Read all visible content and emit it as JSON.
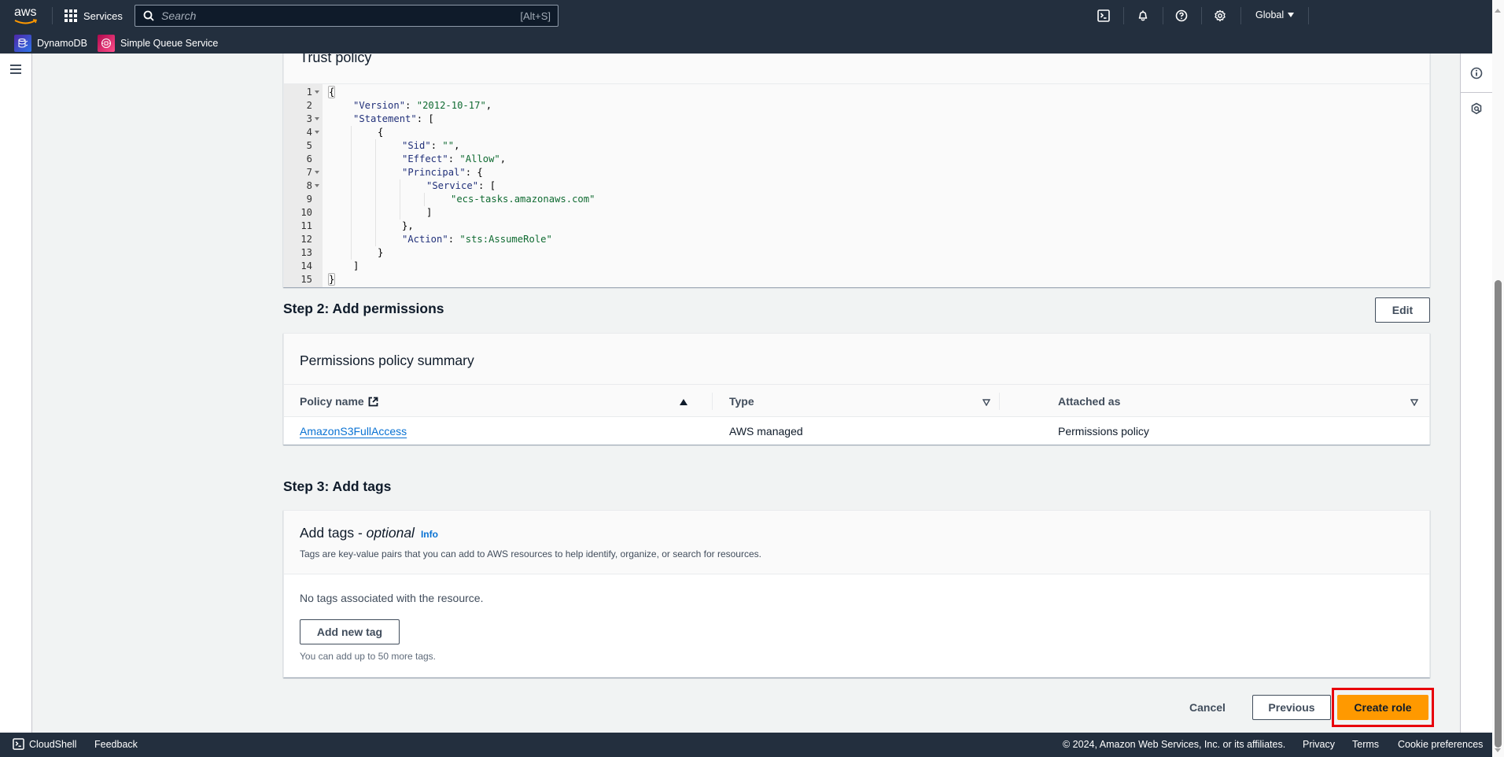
{
  "topnav": {
    "logo_text": "aws",
    "services_label": "Services",
    "search_placeholder": "Search",
    "search_shortcut": "[Alt+S]",
    "icons": [
      "cloudshell-icon",
      "bell-icon",
      "help-icon",
      "settings-icon"
    ],
    "region_label": "Global",
    "favorites": [
      {
        "label": "DynamoDB",
        "icon": "dynamodb-icon",
        "color": "#3f48cc"
      },
      {
        "label": "Simple Queue Service",
        "icon": "sqs-icon",
        "color": "#e7157b"
      }
    ]
  },
  "trust_policy": {
    "title": "Trust policy",
    "lines": [
      {
        "n": "1",
        "fold": true,
        "indent": 0,
        "html": "{"
      },
      {
        "n": "2",
        "fold": false,
        "indent": 1,
        "key": "\"Version\"",
        "sep": ": ",
        "str": "\"2012-10-17\"",
        "tail": ","
      },
      {
        "n": "3",
        "fold": true,
        "indent": 1,
        "key": "\"Statement\"",
        "sep": ": [",
        "str": "",
        "tail": ""
      },
      {
        "n": "4",
        "fold": true,
        "indent": 2,
        "plain": "{"
      },
      {
        "n": "5",
        "fold": false,
        "indent": 3,
        "key": "\"Sid\"",
        "sep": ": ",
        "str": "\"\"",
        "tail": ","
      },
      {
        "n": "6",
        "fold": false,
        "indent": 3,
        "key": "\"Effect\"",
        "sep": ": ",
        "str": "\"Allow\"",
        "tail": ","
      },
      {
        "n": "7",
        "fold": true,
        "indent": 3,
        "key": "\"Principal\"",
        "sep": ": {",
        "str": "",
        "tail": ""
      },
      {
        "n": "8",
        "fold": true,
        "indent": 4,
        "key": "\"Service\"",
        "sep": ": [",
        "str": "",
        "tail": ""
      },
      {
        "n": "9",
        "fold": false,
        "indent": 5,
        "str": "\"ecs-tasks.amazonaws.com\""
      },
      {
        "n": "10",
        "fold": false,
        "indent": 4,
        "plain": "]"
      },
      {
        "n": "11",
        "fold": false,
        "indent": 3,
        "plain": "},"
      },
      {
        "n": "12",
        "fold": false,
        "indent": 3,
        "key": "\"Action\"",
        "sep": ": ",
        "str": "\"sts:AssumeRole\"",
        "tail": ""
      },
      {
        "n": "13",
        "fold": false,
        "indent": 2,
        "plain": "}"
      },
      {
        "n": "14",
        "fold": false,
        "indent": 1,
        "plain": "]"
      },
      {
        "n": "15",
        "fold": false,
        "indent": 0,
        "html": "}"
      }
    ]
  },
  "step2": {
    "heading": "Step 2: Add permissions",
    "edit_label": "Edit",
    "panel_title": "Permissions policy summary",
    "columns": [
      "Policy name",
      "Type",
      "Attached as"
    ],
    "rows": [
      {
        "policy_name": "AmazonS3FullAccess",
        "type": "AWS managed",
        "attached_as": "Permissions policy"
      }
    ]
  },
  "step3": {
    "heading": "Step 3: Add tags",
    "panel_title": "Add tags - ",
    "panel_title_em": "optional",
    "info_label": "Info",
    "description": "Tags are key-value pairs that you can add to AWS resources to help identify, organize, or search for resources.",
    "empty_text": "No tags associated with the resource.",
    "add_tag_label": "Add new tag",
    "hint": "You can add up to 50 more tags."
  },
  "actions": {
    "cancel_label": "Cancel",
    "previous_label": "Previous",
    "create_label": "Create role"
  },
  "footer": {
    "cloudshell_label": "CloudShell",
    "feedback_label": "Feedback",
    "copyright": "© 2024, Amazon Web Services, Inc. or its affiliates.",
    "links": [
      "Privacy",
      "Terms",
      "Cookie preferences"
    ]
  }
}
